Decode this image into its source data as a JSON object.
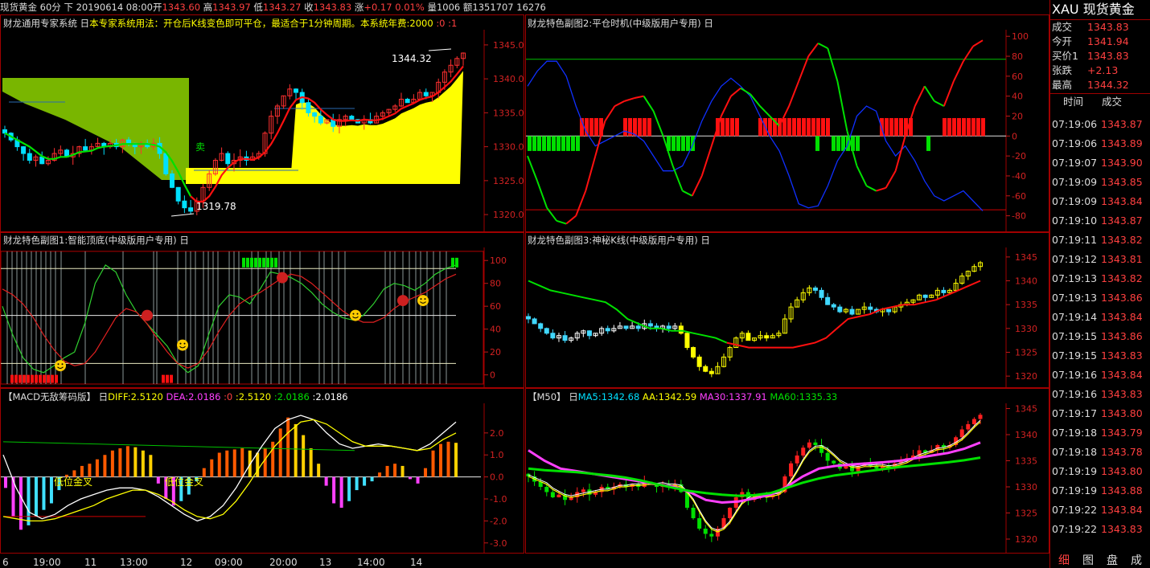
{
  "top_bar": {
    "symbol": "现货黄金",
    "period": "60分",
    "direction": "下",
    "datetime": "20190614 08:00",
    "open_label": "开",
    "open": "1343.60",
    "high_label": "高",
    "high": "1343.97",
    "low_label": "低",
    "low": "1343.27",
    "close_label": "收",
    "close": "1343.83",
    "change_label": "涨",
    "change": "+0.17",
    "change_pct": "0.01%",
    "volume_label": "量",
    "volume": "1006",
    "amount_label": "额",
    "amount": "1351707",
    "extra": "16276"
  },
  "panels": {
    "main": {
      "title": "财龙通用专家系统",
      "usage_prefix": "日",
      "usage_text": "本专家系统用法：开仓后K线变色即可平仓，最适合于1分钟周期。本系统年费:2000",
      "usage_suffix": ":0 :1",
      "high_marker": "1344.32",
      "low_marker": "1319.78",
      "sell_marker": "卖",
      "y_ticks": [
        "1345.0",
        "1340.0",
        "1335.0",
        "1330.0",
        "1325.0",
        "1320.0"
      ]
    },
    "sub2": {
      "title": "财龙特色副图2:平仓时机(中级版用户专用)",
      "icon": "日",
      "y_ticks": [
        "100",
        "80",
        "60",
        "40",
        "20",
        "0",
        "-20",
        "-40",
        "-60",
        "-80"
      ]
    },
    "sub1": {
      "title": "财龙特色副图1:智能顶底(中级版用户专用)",
      "icon": "日",
      "y_ticks": [
        "100",
        "80",
        "60",
        "40",
        "20",
        "0"
      ]
    },
    "sub3": {
      "title": "财龙特色副图3:神秘K线(中级版用户专用)",
      "icon": "日",
      "y_ticks": [
        "1345",
        "1340",
        "1335",
        "1330",
        "1325",
        "1320"
      ]
    },
    "macd": {
      "title": "【MACD无敌筹码版】",
      "icon": "日",
      "diff": "DIFF:2.5120",
      "dea": "DEA:2.0186",
      "v0": ":0",
      "v1": ":2.5120",
      "v2": ":2.0186",
      "v3": ":2.0186",
      "label_low_cross": "低位金叉",
      "label_low_cross2": "低位金叉",
      "y_ticks": [
        "2.0",
        "1.0",
        "0.0",
        "-1.0",
        "-2.0",
        "-3.0"
      ]
    },
    "ma": {
      "title": "【M50】",
      "icon": "日",
      "ma5": "MA5:1342.68",
      "aa": "AA:1342.59",
      "ma30": "MA30:1337.91",
      "ma60": "MA60:1335.33",
      "y_ticks": [
        "1345",
        "1340",
        "1335",
        "1330",
        "1325",
        "1320"
      ]
    }
  },
  "x_axis": [
    "6",
    "19:00",
    "11",
    "13:00",
    "12",
    "09:00",
    "20:00",
    "13",
    "14:00",
    "14"
  ],
  "quote_panel": {
    "code": "XAU",
    "name": "现货黄金",
    "rows": [
      {
        "label": "成交",
        "value": "1343.83"
      },
      {
        "label": "今开",
        "value": "1341.94"
      },
      {
        "label": "买价1",
        "value": "1343.83"
      },
      {
        "label": "张跌",
        "value": "+2.13"
      },
      {
        "label": "最高",
        "value": "1344.32"
      }
    ],
    "tick_header": {
      "time": "时间",
      "price": "成交"
    },
    "ticks": [
      {
        "time": "07:19:06",
        "price": "1343.87"
      },
      {
        "time": "07:19:06",
        "price": "1343.89"
      },
      {
        "time": "07:19:07",
        "price": "1343.90"
      },
      {
        "time": "07:19:09",
        "price": "1343.85"
      },
      {
        "time": "07:19:09",
        "price": "1343.84"
      },
      {
        "time": "07:19:10",
        "price": "1343.87"
      },
      {
        "time": "07:19:11",
        "price": "1343.82"
      },
      {
        "time": "07:19:12",
        "price": "1343.81"
      },
      {
        "time": "07:19:13",
        "price": "1343.82"
      },
      {
        "time": "07:19:13",
        "price": "1343.86"
      },
      {
        "time": "07:19:14",
        "price": "1343.84"
      },
      {
        "time": "07:19:15",
        "price": "1343.86"
      },
      {
        "time": "07:19:15",
        "price": "1343.83"
      },
      {
        "time": "07:19:16",
        "price": "1343.84"
      },
      {
        "time": "07:19:16",
        "price": "1343.83"
      },
      {
        "time": "07:19:17",
        "price": "1343.80"
      },
      {
        "time": "07:19:18",
        "price": "1343.79"
      },
      {
        "time": "07:19:18",
        "price": "1343.78"
      },
      {
        "time": "07:19:19",
        "price": "1343.80"
      },
      {
        "time": "07:19:19",
        "price": "1343.88"
      },
      {
        "time": "07:19:22",
        "price": "1343.84"
      },
      {
        "time": "07:19:22",
        "price": "1343.83"
      }
    ],
    "tabs": [
      "细",
      "图",
      "盘",
      "成"
    ]
  },
  "colors": {
    "up": "#ff3030",
    "down": "#00e0ff",
    "ma_green": "#00e000",
    "ma_red": "#ff1010",
    "yellow": "#ffff00",
    "magenta": "#ff40ff",
    "axis": "#d22222",
    "blue": "#1030ff"
  },
  "chart_data": [
    {
      "type": "candlestick",
      "ylim": [
        1318,
        1347
      ],
      "closes": [
        1332,
        1331,
        1330,
        1329,
        1328,
        1328.5,
        1327.5,
        1328,
        1329,
        1329.5,
        1328.5,
        1329,
        1330,
        1329.5,
        1330,
        1330.5,
        1330,
        1330.5,
        1330,
        1331,
        1330.5,
        1330,
        1330.5,
        1330,
        1330.5,
        1329,
        1326,
        1324,
        1322,
        1321,
        1320.5,
        1322,
        1324,
        1326,
        1328,
        1329,
        1327.5,
        1328,
        1328.5,
        1328,
        1328.5,
        1329,
        1332,
        1334.5,
        1336,
        1337.5,
        1338.5,
        1338,
        1336.5,
        1335,
        1334.5,
        1333.5,
        1334,
        1333,
        1334,
        1334.5,
        1334,
        1333.5,
        1334,
        1333.5,
        1334.5,
        1335,
        1335.5,
        1336,
        1337,
        1336.5,
        1337,
        1338,
        1337.5,
        1338,
        1339.5,
        1341,
        1342,
        1343,
        1343.8
      ]
    },
    {
      "type": "line",
      "title": "平仓时机",
      "ylim": [
        -90,
        105
      ],
      "series": [
        {
          "values": [
            -20,
            -45,
            -72,
            -85,
            -88,
            -80,
            -55,
            -20,
            15,
            30,
            35,
            38,
            40,
            25,
            0,
            -30,
            -55,
            -60,
            -40,
            -10,
            20,
            40,
            48,
            42,
            30,
            20,
            10,
            30,
            55,
            80,
            93,
            88,
            55,
            5,
            -30,
            -50,
            -55,
            -52,
            -35,
            0,
            30,
            50,
            35,
            30,
            55,
            75,
            90,
            96
          ]
        },
        {
          "values": [
            50,
            65,
            75,
            75,
            60,
            30,
            5,
            -10,
            -5,
            0,
            5,
            2,
            -5,
            -20,
            -35,
            -35,
            -30,
            -10,
            15,
            35,
            50,
            58,
            50,
            40,
            20,
            0,
            -15,
            -40,
            -68,
            -72,
            -70,
            -50,
            -25,
            -10,
            20,
            30,
            25,
            -5,
            -20,
            -10,
            -25,
            -45,
            -60,
            -65,
            -60,
            -55,
            -65,
            -75
          ]
        }
      ]
    },
    {
      "type": "line",
      "title": "智能顶底",
      "ylim": [
        -8,
        110
      ],
      "series": [
        {
          "values": [
            60,
            35,
            15,
            5,
            2,
            8,
            15,
            20,
            45,
            80,
            96,
            90,
            70,
            55,
            45,
            35,
            25,
            10,
            2,
            8,
            35,
            60,
            70,
            68,
            62,
            75,
            90,
            88,
            85,
            80,
            72,
            62,
            55,
            50,
            48,
            52,
            62,
            75,
            80,
            78,
            74,
            80,
            88,
            93,
            96
          ]
        },
        {
          "values": [
            75,
            70,
            62,
            50,
            35,
            22,
            12,
            8,
            10,
            20,
            35,
            50,
            58,
            55,
            45,
            32,
            20,
            10,
            6,
            10,
            22,
            38,
            52,
            62,
            68,
            72,
            78,
            84,
            88,
            86,
            80,
            72,
            64,
            56,
            50,
            46,
            46,
            50,
            58,
            64,
            68,
            72,
            78,
            84,
            88
          ]
        }
      ]
    },
    {
      "type": "bar",
      "title": "MACD",
      "ylim": [
        -3.3,
        3.2
      ],
      "values": [
        -0.5,
        -1.8,
        -2.4,
        -2.2,
        -1.8,
        -1.5,
        -1.2,
        -0.6,
        0.1,
        0.3,
        0.5,
        0.6,
        0.8,
        1.0,
        1.2,
        1.3,
        1.4,
        1.35,
        1.2,
        1.0,
        -0.3,
        -1.0,
        -1.3,
        -1.1,
        -0.8,
        -0.2,
        0.4,
        0.8,
        1.1,
        1.2,
        1.25,
        1.3,
        1.2,
        1.1,
        1.3,
        1.6,
        2.2,
        2.7,
        2.4,
        1.9,
        1.3,
        0.6,
        -0.4,
        -1.2,
        -1.4,
        -1.1,
        -0.6,
        -0.4,
        -0.2,
        0.2,
        0.5,
        0.6,
        0.5,
        -0.1,
        -0.3,
        0.4,
        1.2,
        1.5,
        1.6,
        1.55
      ]
    },
    {
      "type": "line",
      "title": "M50",
      "ylim": [
        1318,
        1346
      ],
      "series": [
        {
          "name": "MA30",
          "values": [
            1337,
            1335,
            1333.5,
            1333,
            1332.5,
            1332,
            1331.5,
            1331,
            1330.5,
            1330,
            1329,
            1327.5,
            1327,
            1327.2,
            1327.8,
            1328.5,
            1330,
            1332,
            1333.5,
            1334,
            1334.3,
            1334.5,
            1334.7,
            1335,
            1335.5,
            1336,
            1336.5,
            1337.3,
            1338.5
          ]
        },
        {
          "name": "MA60",
          "values": [
            1333.5,
            1333.2,
            1333,
            1332.8,
            1332.5,
            1332.2,
            1331.8,
            1331.2,
            1330.5,
            1329.8,
            1329.2,
            1328.8,
            1328.5,
            1328.3,
            1328.4,
            1328.8,
            1329.8,
            1330.8,
            1331.6,
            1332.2,
            1332.6,
            1333,
            1333.4,
            1333.8,
            1334.1,
            1334.4,
            1334.7,
            1335.1,
            1335.6
          ]
        }
      ]
    }
  ]
}
